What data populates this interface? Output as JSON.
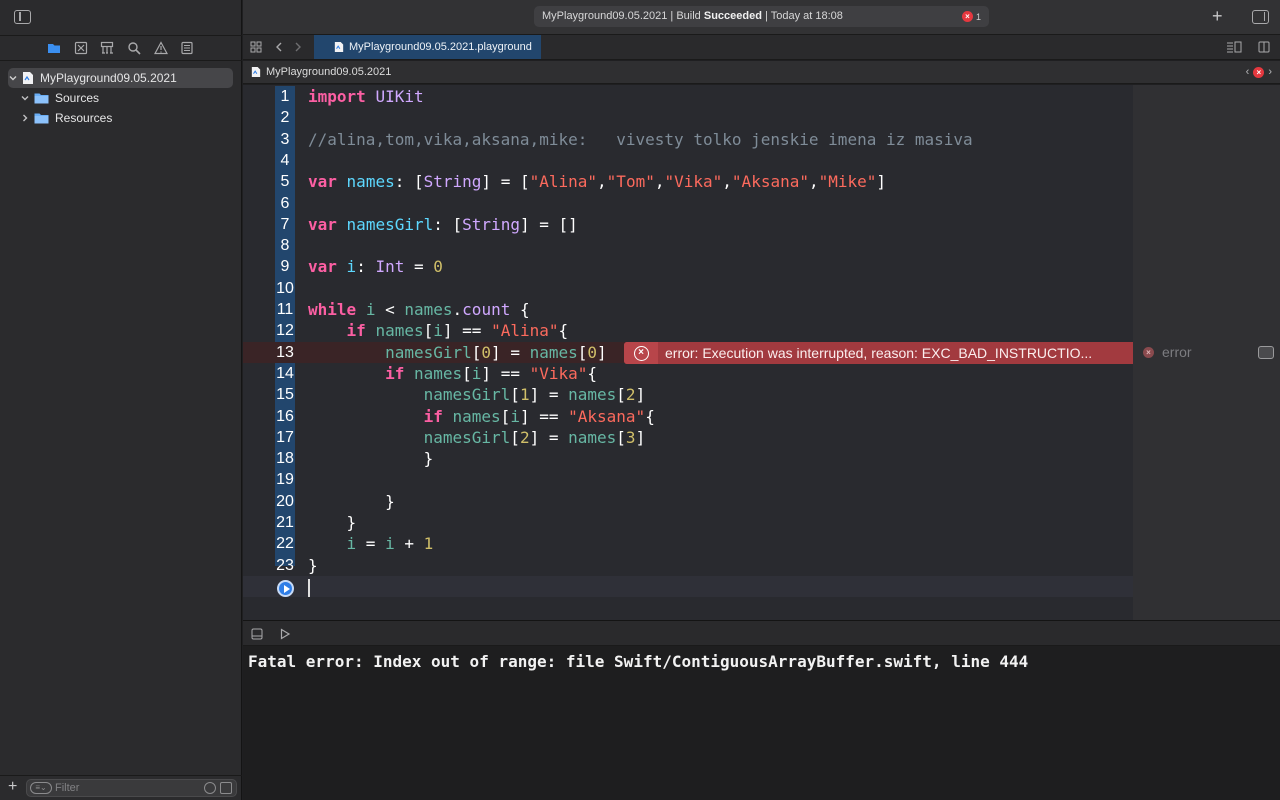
{
  "toolbar": {
    "activity_prefix": "MyPlayground09.05.2021 | Build ",
    "activity_status": "Succeeded",
    "activity_suffix": " | Today at 18:08",
    "error_count": "1",
    "add_label": "+"
  },
  "navigator": {
    "items": [
      {
        "label": "MyPlayground09.05.2021",
        "icon": "playground-file-icon"
      },
      {
        "label": "Sources",
        "icon": "folder-icon"
      },
      {
        "label": "Resources",
        "icon": "folder-icon"
      }
    ],
    "filter_placeholder": "Filter",
    "add_label": "+"
  },
  "tabs": [
    {
      "label": "MyPlayground09.05.2021.playground",
      "active": true
    }
  ],
  "jumpbar": {
    "path": "MyPlayground09.05.2021"
  },
  "editor": {
    "line_numbers": [
      "1",
      "2",
      "3",
      "4",
      "5",
      "6",
      "7",
      "8",
      "9",
      "10",
      "11",
      "12",
      "13",
      "14",
      "15",
      "16",
      "17",
      "18",
      "19",
      "20",
      "21",
      "22",
      "23"
    ],
    "lines": [
      "import UIKit",
      "",
      "//alina,tom,vika,aksana,mike:   vivesty tolko jenskie imena iz masiva",
      "",
      "var names: [String] = [\"Alina\",\"Tom\",\"Vika\",\"Aksana\",\"Mike\"]",
      "",
      "var namesGirl: [String] = []",
      "",
      "var i: Int = 0",
      "",
      "while i < names.count {",
      "    if names[i] == \"Alina\"{",
      "        namesGirl[0] = names[0]",
      "        if names[i] == \"Vika\"{",
      "            namesGirl[1] = names[2]",
      "            if names[i] == \"Aksana\"{",
      "            namesGirl[2] = names[3]",
      "            }",
      "",
      "        }",
      "    }",
      "    i = i + 1",
      "}"
    ],
    "error_message": "error: Execution was interrupted, reason: EXC_BAD_INSTRUCTIO...",
    "result_label": "error"
  },
  "console": {
    "output": "Fatal error: Index out of range: file Swift/ContiguousArrayBuffer.swift, line 444"
  },
  "colors": {
    "keyword": "#fc5fa3",
    "type": "#d0a8ff",
    "declaration": "#5dd8ff",
    "reference": "#67b7a4",
    "string": "#fc6a5d",
    "number": "#d0bf69",
    "comment": "#7f8c98",
    "selection": "#22466d",
    "error": "#a23a3f"
  }
}
